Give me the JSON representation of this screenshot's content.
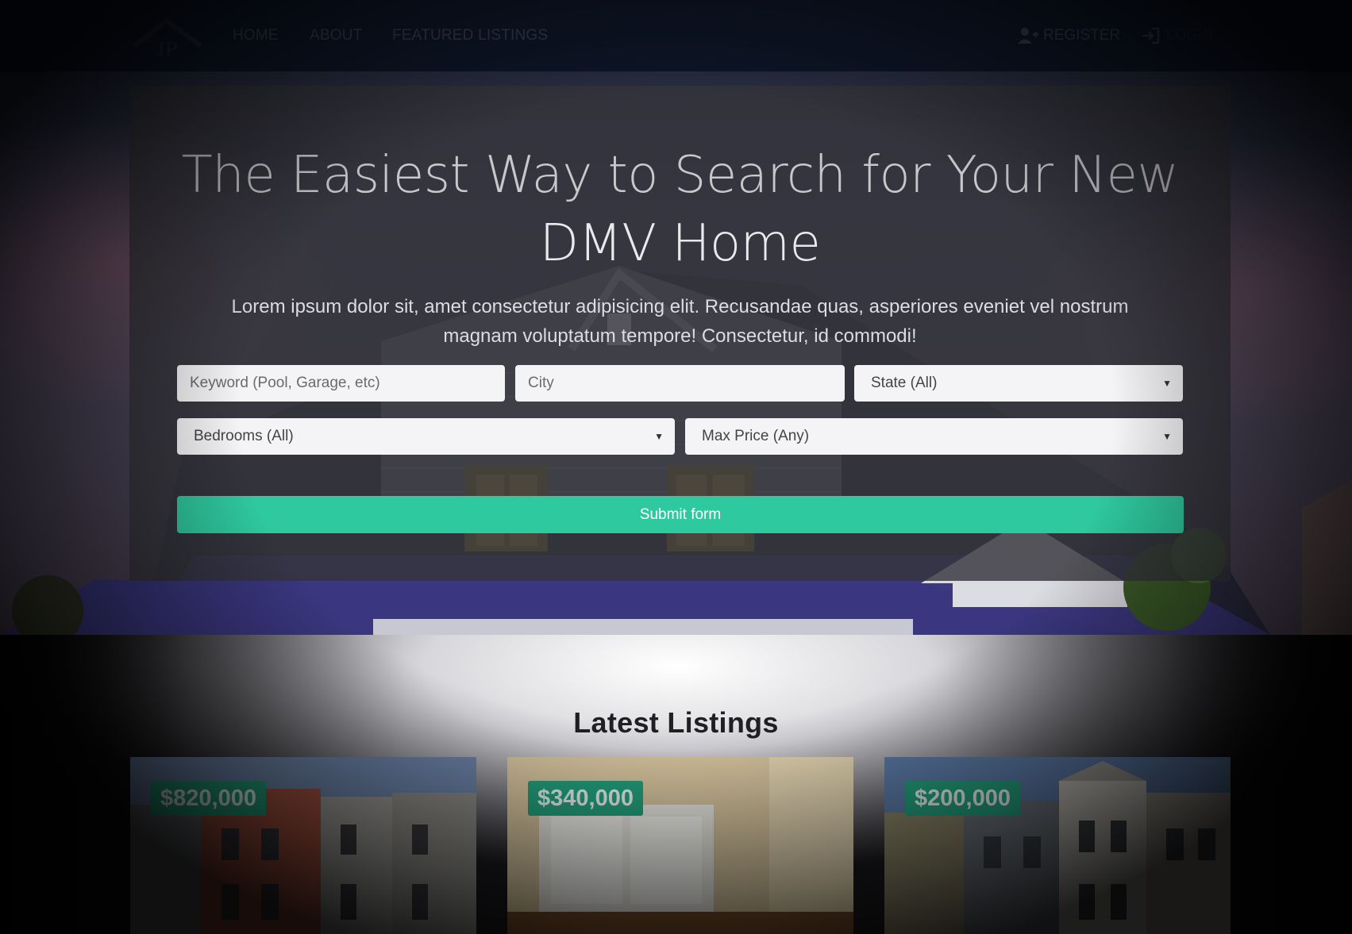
{
  "navbar": {
    "logo_text": "JP",
    "links": [
      "HOME",
      "ABOUT",
      "FEATURED LISTINGS"
    ],
    "register_label": "REGISTER",
    "login_label": "LOGIN"
  },
  "hero": {
    "headline_line1": "The Easiest Way to Search for Your New",
    "headline_line2": "DMV Home",
    "lead": "Lorem ipsum dolor sit, amet consectetur adipisicing elit. Recusandae quas, asperiores eveniet vel nostrum magnam voluptatum tempore! Consectetur, id commodi!"
  },
  "search_form": {
    "keyword_placeholder": "Keyword (Pool, Garage, etc)",
    "city_placeholder": "City",
    "state_select": "State (All)",
    "bedrooms_select": "Bedrooms (All)",
    "max_price_select": "Max Price (Any)",
    "submit_label": "Submit form"
  },
  "latest_listings": {
    "title": "Latest Listings",
    "cards": [
      {
        "price": "$820,000"
      },
      {
        "price": "$340,000"
      },
      {
        "price": "$200,000"
      }
    ]
  },
  "colors": {
    "accent": "#2fc9a0",
    "badge": "#24a27e",
    "navbar": "#0d1526"
  }
}
